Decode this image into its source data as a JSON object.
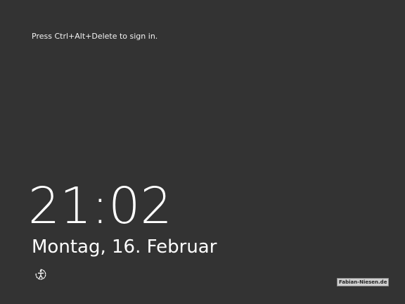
{
  "lock_screen": {
    "prompt_text": "Press Ctrl+Alt+Delete to sign in.",
    "time": "21:02",
    "date": "Montag, 16. Februar",
    "ease_of_access_icon": "ease-of-access-icon",
    "watermark_text": "Fabian-Niesen.de"
  },
  "colors": {
    "background": "#333333",
    "text": "#ffffff"
  }
}
